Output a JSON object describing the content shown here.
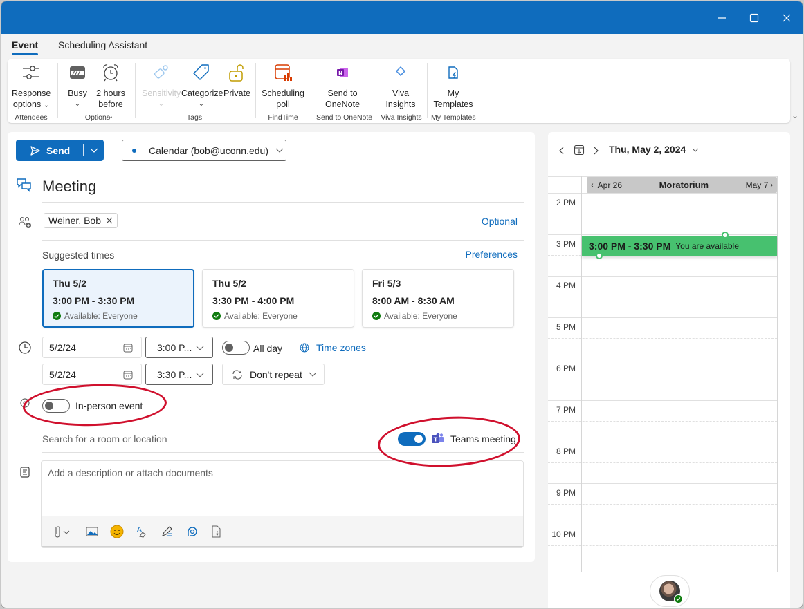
{
  "window": {
    "controls": {
      "minimize": "minimize",
      "maximize": "maximize",
      "close": "close"
    }
  },
  "tabs": [
    {
      "label": "Event",
      "active": true
    },
    {
      "label": "Scheduling Assistant",
      "active": false
    }
  ],
  "ribbon": {
    "groups": [
      {
        "label": "Attendees",
        "buttons": [
          {
            "line1": "Response",
            "line2": "options",
            "icon": "sliders-icon",
            "dropdown": true
          }
        ]
      },
      {
        "label": "Options",
        "buttons": [
          {
            "line1": "Busy",
            "line2": "",
            "icon": "busy-icon",
            "dropdown": true
          },
          {
            "line1": "2 hours",
            "line2": "before",
            "icon": "alarm-clock-icon",
            "dropdown": true
          }
        ]
      },
      {
        "label": "Tags",
        "buttons": [
          {
            "line1": "Sensitivity",
            "line2": "",
            "icon": "sensitivity-icon",
            "dropdown": true,
            "disabled": true
          },
          {
            "line1": "Categorize",
            "line2": "",
            "icon": "tag-icon",
            "dropdown": true
          },
          {
            "line1": "Private",
            "line2": "",
            "icon": "lock-open-icon",
            "dropdown": false
          }
        ]
      },
      {
        "label": "FindTime",
        "buttons": [
          {
            "line1": "Scheduling",
            "line2": "poll",
            "icon": "scheduling-poll-icon"
          }
        ]
      },
      {
        "label": "Send to OneNote",
        "buttons": [
          {
            "line1": "Send to",
            "line2": "OneNote",
            "icon": "onenote-icon"
          }
        ]
      },
      {
        "label": "Viva Insights",
        "buttons": [
          {
            "line1": "Viva",
            "line2": "Insights",
            "icon": "viva-insights-icon"
          }
        ]
      },
      {
        "label": "My Templates",
        "buttons": [
          {
            "line1": "My",
            "line2": "Templates",
            "icon": "templates-icon"
          }
        ]
      }
    ]
  },
  "form": {
    "send_label": "Send",
    "calendar_select": "Calendar (bob@uconn.edu)",
    "title": "Meeting",
    "attendees": [
      "Weiner, Bob"
    ],
    "optional_link": "Optional",
    "suggested_label": "Suggested times",
    "preferences_link": "Preferences",
    "suggestions": [
      {
        "day": "Thu 5/2",
        "time": "3:00 PM - 3:30 PM",
        "availability": "Available: Everyone",
        "selected": true
      },
      {
        "day": "Thu 5/2",
        "time": "3:30 PM - 4:00 PM",
        "availability": "Available: Everyone",
        "selected": false
      },
      {
        "day": "Fri 5/3",
        "time": "8:00 AM - 8:30 AM",
        "availability": "Available: Everyone",
        "selected": false
      }
    ],
    "start_date": "5/2/24",
    "start_time": "3:00 P...",
    "end_date": "5/2/24",
    "end_time": "3:30 P...",
    "all_day_label": "All day",
    "all_day": false,
    "time_zones_link": "Time zones",
    "repeat": "Don't repeat",
    "in_person_label": "In-person event",
    "in_person": false,
    "location_placeholder": "Search for a room or location",
    "teams_label": "Teams meeting",
    "teams_on": true,
    "description_placeholder": "Add a description or attach documents",
    "annotations": "red circles highlight In-person event toggle and Teams meeting toggle"
  },
  "calendar": {
    "date_label": "Thu, May 2, 2024",
    "banner": {
      "prev": "Apr 26",
      "title": "Moratorium",
      "next": "May 7"
    },
    "hours": [
      "2 PM",
      "3 PM",
      "4 PM",
      "5 PM",
      "6 PM",
      "7 PM",
      "8 PM",
      "9 PM",
      "10 PM"
    ],
    "event": {
      "time": "3:00 PM - 3:30 PM",
      "status": "You are available",
      "color": "#47c16f"
    }
  },
  "colors": {
    "accent": "#0f6cbd",
    "available_green": "#107c10",
    "annotation_red": "#d0102d"
  }
}
